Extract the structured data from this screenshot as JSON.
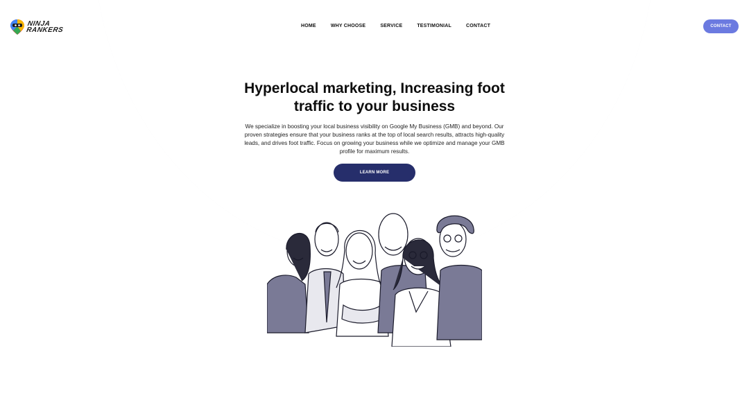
{
  "brand": {
    "line1": "NINJA",
    "line2": "RANKERS",
    "logo_icon": "map-pin-ninja-icon"
  },
  "nav": {
    "items": [
      "HOME",
      "WHY CHOOSE",
      "SERVICE",
      "TESTIMONIAL",
      "CONTACT"
    ]
  },
  "header": {
    "contact_label": "CONTACT"
  },
  "hero": {
    "title_line1": "Hyperlocal marketing, Increasing foot",
    "title_line2": "traffic to your business",
    "description": "We specialize in boosting your local business visibility on Google My Business (GMB) and beyond. Our proven strategies ensure that your business ranks at the top of local search results, attracts high-quality leads, and drives foot traffic. Focus on growing your business while we optimize and manage your GMB profile for maximum results.",
    "cta_label": "LEARN MORE"
  },
  "colors": {
    "hero_bg": "#eef0f6",
    "accent": "#6b7ae0",
    "cta": "#262e6b",
    "illustration_shade": "#7a7a96"
  }
}
